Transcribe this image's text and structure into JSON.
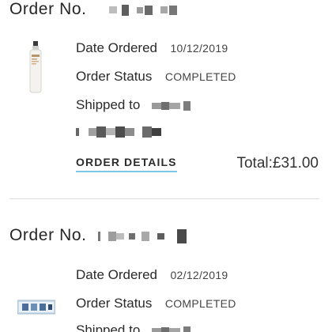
{
  "orders": [
    {
      "title": "Order No.",
      "date_label": "Date Ordered",
      "date_value": "10/12/2019",
      "status_label": "Order Status",
      "status_value": "COMPLETED",
      "shipped_label": "Shipped to",
      "details_link": "ORDER DETAILS",
      "total": "Total:£31.00"
    },
    {
      "title": "Order No.",
      "date_label": "Date Ordered",
      "date_value": "02/12/2019",
      "status_label": "Order Status",
      "status_value": "COMPLETED",
      "shipped_label": "Shipped to"
    }
  ],
  "colors": {
    "link_underline": "#7ec6e6",
    "redaction": "#8a8a8a",
    "divider": "#dcdcdc"
  }
}
